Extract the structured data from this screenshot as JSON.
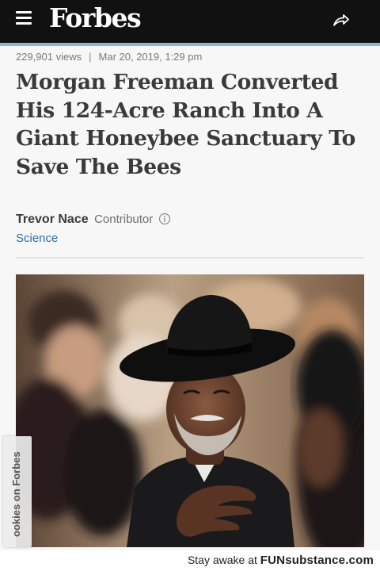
{
  "header": {
    "brand": "Forbes",
    "menu_icon": "hamburger-menu-icon",
    "share_icon": "share-arrow-icon",
    "background_color": "#111111",
    "accent_color": "#8fb3d4"
  },
  "article": {
    "views": "229,901 views",
    "separator": "|",
    "date": "Mar 20, 2019, 1:29 pm",
    "headline": "Morgan Freeman Converted His 124-Acre Ranch Into A Giant Honeybee Sanctuary To Save The Bees",
    "author": "Trevor Nace",
    "author_role": "Contributor",
    "info_icon": "info-circle-icon",
    "section": "Science",
    "link_color": "#2e6fa8"
  },
  "side_tab": {
    "label": "ookies on Forbes"
  },
  "watermark": {
    "prefix": "Stay awake at ",
    "brand": "FUNsubstance.com"
  }
}
